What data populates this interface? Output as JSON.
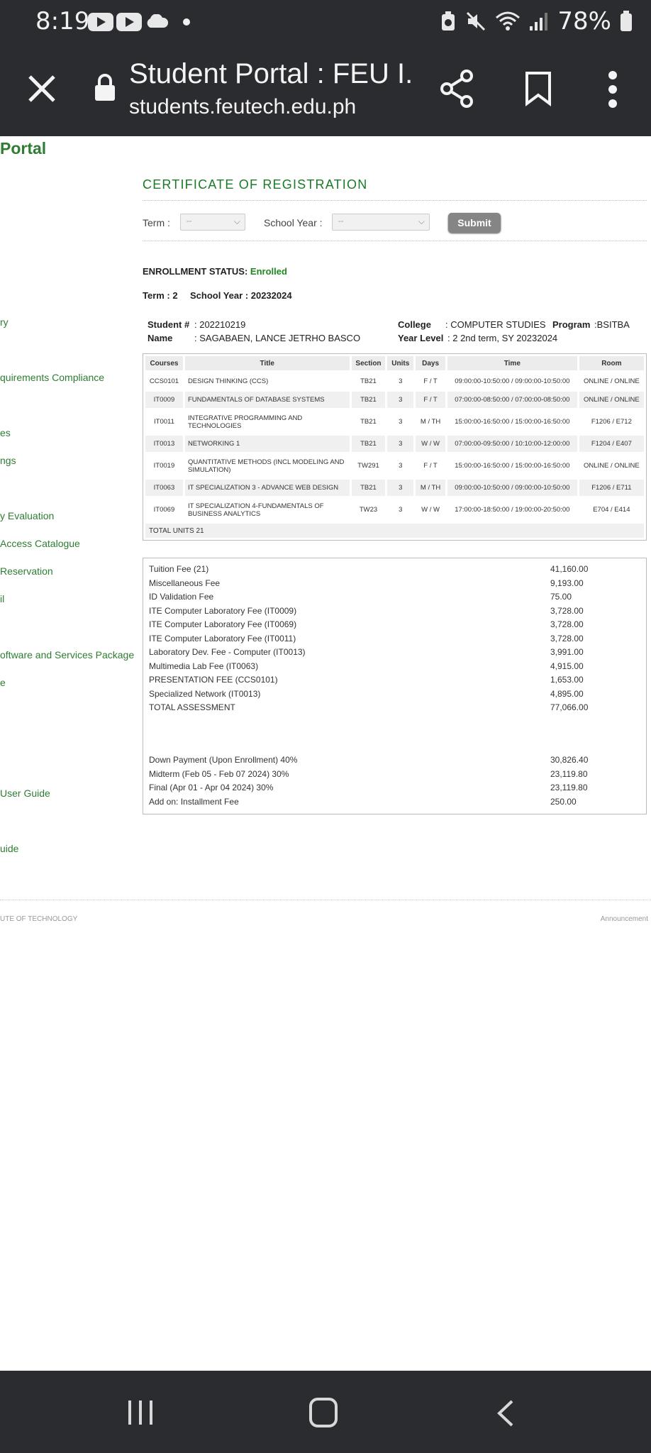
{
  "status_bar": {
    "time": "8:19",
    "battery": "78%"
  },
  "browser": {
    "title": "Student Portal : FEU I...",
    "url": "students.feutech.edu.ph"
  },
  "sidebar": {
    "brand": "Portal",
    "items": [
      "ry",
      "quirements Compliance",
      "es",
      "ngs",
      "y Evaluation",
      "Access Catalogue",
      "Reservation",
      "il",
      "oftware and Services Package",
      "e",
      "User Guide",
      "uide"
    ]
  },
  "form": {
    "heading": "CERTIFICATE OF REGISTRATION",
    "term_label": "Term :",
    "term_value": "--",
    "year_label": "School Year :",
    "year_value": "--",
    "submit": "Submit"
  },
  "enrollment": {
    "status_label": "ENROLLMENT STATUS:",
    "status_value": "Enrolled",
    "term_line": "Term : 2",
    "year_line": "School Year : 20232024"
  },
  "student": {
    "id_label": "Student #",
    "id_value": ": 202210219",
    "name_label": "Name",
    "name_value": ": SAGABAEN, LANCE JETRHO BASCO",
    "college_label": "College",
    "college_value": ": COMPUTER STUDIES",
    "program_label": "Program",
    "program_value": ":BSITBA",
    "level_label": "Year Level",
    "level_value": ": 2    2nd term, SY 20232024"
  },
  "schedule": {
    "headers": [
      "Courses",
      "Title",
      "Section",
      "Units",
      "Days",
      "Time",
      "Room"
    ],
    "rows": [
      [
        "CCS0101",
        "DESIGN THINKING (CCS)",
        "TB21",
        "3",
        "F / T",
        "09:00:00-10:50:00 / 09:00:00-10:50:00",
        "ONLINE / ONLINE"
      ],
      [
        "IT0009",
        "FUNDAMENTALS OF DATABASE SYSTEMS",
        "TB21",
        "3",
        "F / T",
        "07:00:00-08:50:00 / 07:00:00-08:50:00",
        "ONLINE / ONLINE"
      ],
      [
        "IT0011",
        "INTEGRATIVE PROGRAMMING AND TECHNOLOGIES",
        "TB21",
        "3",
        "M / TH",
        "15:00:00-16:50:00 / 15:00:00-16:50:00",
        "F1206 / E712"
      ],
      [
        "IT0013",
        "NETWORKING 1",
        "TB21",
        "3",
        "W / W",
        "07:00:00-09:50:00 / 10:10:00-12:00:00",
        "F1204 / E407"
      ],
      [
        "IT0019",
        "QUANTITATIVE METHODS (INCL MODELING AND SIMULATION)",
        "TW291",
        "3",
        "F / T",
        "15:00:00-16:50:00 / 15:00:00-16:50:00",
        "ONLINE / ONLINE"
      ],
      [
        "IT0063",
        "IT SPECIALIZATION 3 - ADVANCE WEB DESIGN",
        "TB21",
        "3",
        "M / TH",
        "09:00:00-10:50:00 / 09:00:00-10:50:00",
        "F1206 / E711"
      ],
      [
        "IT0069",
        "IT SPECIALIZATION 4-FUNDAMENTALS OF BUSINESS ANALYTICS",
        "TW23",
        "3",
        "W / W",
        "17:00:00-18:50:00 / 19:00:00-20:50:00",
        "E704 / E414"
      ]
    ],
    "total": "TOTAL UNITS 21"
  },
  "fees": [
    {
      "label": "Tuition Fee (21)",
      "amount": "41,160.00"
    },
    {
      "label": "Miscellaneous Fee",
      "amount": "9,193.00"
    },
    {
      "label": "ID Validation Fee",
      "amount": "75.00"
    },
    {
      "label": "ITE Computer Laboratory Fee (IT0009)",
      "amount": "3,728.00"
    },
    {
      "label": "ITE Computer Laboratory Fee (IT0069)",
      "amount": "3,728.00"
    },
    {
      "label": "ITE Computer Laboratory Fee (IT0011)",
      "amount": "3,728.00"
    },
    {
      "label": "Laboratory Dev. Fee - Computer (IT0013)",
      "amount": "3,991.00"
    },
    {
      "label": "Multimedia Lab Fee (IT0063)",
      "amount": "4,915.00"
    },
    {
      "label": "PRESENTATION FEE (CCS0101)",
      "amount": "1,653.00"
    },
    {
      "label": "Specialized Network (IT0013)",
      "amount": "4,895.00"
    },
    {
      "label": "TOTAL ASSESSMENT",
      "amount": "77,066.00"
    }
  ],
  "payments": [
    {
      "label": "Down Payment (Upon Enrollment) 40%",
      "amount": "30,826.40"
    },
    {
      "label": "Midterm (Feb 05 - Feb 07 2024) 30%",
      "amount": "23,119.80"
    },
    {
      "label": "Final (Apr 01 - Apr 04 2024) 30%",
      "amount": "23,119.80"
    },
    {
      "label": "Add on: Installment Fee",
      "amount": "250.00"
    }
  ],
  "footer": {
    "left": "UTE OF TECHNOLOGY",
    "right": "Announcement"
  }
}
